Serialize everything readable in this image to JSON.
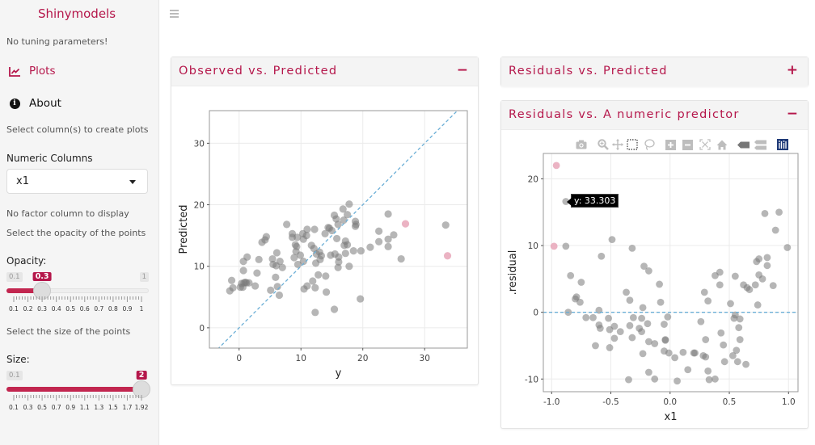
{
  "sidebar": {
    "brand": "Shinymodels",
    "no_tuning": "No tuning parameters!",
    "nav": [
      {
        "label": "Plots",
        "icon": "line-chart-icon",
        "active": true
      },
      {
        "label": "About",
        "icon": "info-circle-icon",
        "active": false
      }
    ],
    "select_columns_text": "Select column(s) to create plots",
    "numeric_columns_label": "Numeric Columns",
    "numeric_columns_value": "x1",
    "no_factor_text": "No factor column to display",
    "opacity_help": "Select the opacity of the points",
    "opacity": {
      "label": "Opacity:",
      "min": 0.1,
      "max": 1,
      "value": 0.3,
      "min_label": "0.1",
      "max_label": "1",
      "value_label": "0.3",
      "tick_labels": [
        "0.1",
        "0.2",
        "0.3",
        "0.4",
        "0.5",
        "0.6",
        "0.7",
        "0.8",
        "0.9",
        "1"
      ]
    },
    "size_help": "Select the size of the points",
    "size": {
      "label": "Size:",
      "min": 0.1,
      "max": 2,
      "value": 2,
      "min_label": "0.1",
      "max_label": "",
      "value_label": "2",
      "tick_labels": [
        "0.1",
        "0.3",
        "0.5",
        "0.7",
        "0.9",
        "1.1",
        "1.3",
        "1.5",
        "1.7",
        "1.92"
      ]
    }
  },
  "panels": [
    {
      "title": "Observed vs. Predicted",
      "tool": "−",
      "tool_name": "collapse"
    },
    {
      "title": "Residuals vs. Predicted",
      "tool": "+",
      "tool_name": "expand"
    },
    {
      "title": "Residuals vs. A numeric predictor",
      "tool": "−",
      "tool_name": "collapse"
    }
  ],
  "modebar": [
    "camera-icon",
    "zoom-icon",
    "pan-icon",
    "box-select-icon",
    "lasso-select-icon",
    "zoom-in-icon",
    "zoom-out-icon",
    "autoscale-icon",
    "reset-axes-icon",
    "hover-closest-icon",
    "hover-compare-icon",
    "plotly-logo-icon"
  ],
  "tooltip": "y: 33.303",
  "colors": {
    "accent": "#b5174b",
    "point": "#7a7a7a",
    "highlight": "#e8a6b9",
    "reference_line": "#6aaed6"
  },
  "chart_data": [
    {
      "type": "scatter",
      "title": "Observed vs. Predicted",
      "xlabel": "y",
      "ylabel": "Predicted",
      "xlim": [
        -4.8,
        36.9
      ],
      "ylim": [
        -3.3,
        35.3
      ],
      "xticks": [
        0,
        10,
        20,
        30
      ],
      "yticks": [
        0,
        10,
        20,
        30
      ],
      "grid": true,
      "reference_line": {
        "slope": 1,
        "intercept": 0,
        "style": "dashed"
      },
      "points": [
        [
          -1.5,
          6.0
        ],
        [
          -1.2,
          7.7
        ],
        [
          -1.0,
          6.5
        ],
        [
          0.2,
          6.6
        ],
        [
          0.4,
          7.2
        ],
        [
          0.6,
          6.6
        ],
        [
          0.8,
          7.3
        ],
        [
          1.0,
          7.4
        ],
        [
          1.2,
          7.3
        ],
        [
          1.6,
          7.3
        ],
        [
          0.7,
          9.3
        ],
        [
          0.7,
          10.8
        ],
        [
          1.3,
          11.5
        ],
        [
          2.6,
          6.8
        ],
        [
          2.9,
          8.9
        ],
        [
          3.2,
          11.1
        ],
        [
          3.7,
          13.9
        ],
        [
          4.2,
          14.3
        ],
        [
          4.4,
          14.8
        ],
        [
          5.1,
          6.1
        ],
        [
          5.4,
          11.2
        ],
        [
          5.5,
          10.3
        ],
        [
          5.9,
          8.2
        ],
        [
          6.0,
          10.1
        ],
        [
          6.1,
          12.2
        ],
        [
          6.2,
          6.7
        ],
        [
          6.5,
          5.3
        ],
        [
          6.6,
          10.8
        ],
        [
          7.0,
          9.8
        ],
        [
          7.7,
          16.8
        ],
        [
          8.6,
          14.7
        ],
        [
          8.6,
          15.3
        ],
        [
          8.9,
          11.4
        ],
        [
          9.1,
          13.5
        ],
        [
          9.2,
          12.4
        ],
        [
          9.3,
          13.2
        ],
        [
          9.4,
          14.7
        ],
        [
          9.5,
          10.3
        ],
        [
          9.9,
          11.8
        ],
        [
          10.3,
          15.3
        ],
        [
          10.4,
          14.4
        ],
        [
          10.4,
          10.8
        ],
        [
          10.5,
          6.3
        ],
        [
          10.9,
          15.0
        ],
        [
          11.0,
          16.0
        ],
        [
          11.0,
          6.8
        ],
        [
          11.7,
          13.4
        ],
        [
          11.9,
          7.6
        ],
        [
          12.1,
          12.9
        ],
        [
          12.2,
          16.0
        ],
        [
          12.3,
          6.5
        ],
        [
          12.4,
          10.5
        ],
        [
          12.5,
          12.0
        ],
        [
          12.8,
          8.6
        ],
        [
          13.0,
          12.3
        ],
        [
          13.1,
          11.1
        ],
        [
          13.3,
          11.7
        ],
        [
          13.9,
          15.3
        ],
        [
          14.0,
          8.4
        ],
        [
          14.1,
          5.8
        ],
        [
          14.4,
          16.3
        ],
        [
          14.6,
          16.2
        ],
        [
          14.8,
          11.8
        ],
        [
          15.0,
          15.8
        ],
        [
          15.4,
          18.3
        ],
        [
          15.4,
          3.0
        ],
        [
          15.5,
          12.0
        ],
        [
          15.7,
          17.7
        ],
        [
          15.8,
          14.5
        ],
        [
          16.0,
          16.8
        ],
        [
          16.0,
          9.8
        ],
        [
          16.1,
          11.5
        ],
        [
          16.1,
          10.7
        ],
        [
          16.8,
          19.3
        ],
        [
          16.9,
          17.5
        ],
        [
          17.0,
          13.4
        ],
        [
          17.2,
          14.1
        ],
        [
          17.2,
          12.1
        ],
        [
          17.5,
          13.5
        ],
        [
          17.5,
          18.4
        ],
        [
          17.8,
          20.1
        ],
        [
          17.8,
          10.0
        ],
        [
          18.5,
          12.5
        ],
        [
          18.8,
          17.3
        ],
        [
          18.8,
          16.5
        ],
        [
          18.9,
          16.8
        ],
        [
          19.6,
          4.7
        ],
        [
          19.7,
          12.5
        ],
        [
          21.2,
          13.1
        ],
        [
          22.6,
          15.7
        ],
        [
          22.6,
          14.0
        ],
        [
          24.1,
          18.5
        ],
        [
          24.1,
          14.4
        ],
        [
          24.1,
          13.2
        ],
        [
          25.0,
          15.1
        ],
        [
          26.2,
          11.2
        ],
        [
          33.4,
          16.7
        ],
        [
          12.3,
          2.5
        ]
      ],
      "highlighted_points": [
        [
          26.9,
          16.9
        ],
        [
          33.7,
          11.7
        ]
      ]
    },
    {
      "type": "scatter",
      "title": "Residuals vs. A numeric predictor",
      "xlabel": "x1",
      "ylabel": ".residual",
      "xlim": [
        -1.07,
        1.08
      ],
      "ylim": [
        -11.9,
        23.8
      ],
      "xticks": [
        -1.0,
        -0.5,
        0.0,
        0.5,
        1.0
      ],
      "xtick_labels": [
        "-1.0",
        "-0.5",
        "0.0",
        "0.5",
        "1.0"
      ],
      "yticks": [
        -10,
        0,
        10,
        20
      ],
      "grid": true,
      "reference_line": {
        "slope": 0,
        "intercept": 0,
        "style": "dashed"
      },
      "points": [
        [
          -0.88,
          16.6
        ],
        [
          -0.88,
          9.9
        ],
        [
          -0.84,
          5.5
        ],
        [
          -0.86,
          0.0
        ],
        [
          -0.8,
          2.0
        ],
        [
          -0.79,
          2.3
        ],
        [
          -0.76,
          1.5
        ],
        [
          -0.75,
          4.5
        ],
        [
          -0.71,
          -0.8
        ],
        [
          -0.65,
          -0.8
        ],
        [
          -0.63,
          -5.0
        ],
        [
          -0.6,
          0.3
        ],
        [
          -0.6,
          -1.9
        ],
        [
          -0.59,
          -2.4
        ],
        [
          -0.58,
          8.4
        ],
        [
          -0.52,
          -0.9
        ],
        [
          -0.51,
          -2.6
        ],
        [
          -0.51,
          -5.3
        ],
        [
          -0.49,
          10.9
        ],
        [
          -0.47,
          -2.1
        ],
        [
          -0.47,
          -3.9
        ],
        [
          -0.42,
          -2.9
        ],
        [
          -0.37,
          3.0
        ],
        [
          -0.35,
          -10.1
        ],
        [
          -0.34,
          1.8
        ],
        [
          -0.34,
          -2.0
        ],
        [
          -0.32,
          -3.8
        ],
        [
          -0.32,
          9.6
        ],
        [
          -0.31,
          -0.8
        ],
        [
          -0.26,
          -2.4
        ],
        [
          -0.24,
          -0.9
        ],
        [
          -0.24,
          -2.9
        ],
        [
          -0.23,
          -6.2
        ],
        [
          -0.23,
          0.7
        ],
        [
          -0.22,
          6.9
        ],
        [
          -0.19,
          -1.7
        ],
        [
          -0.18,
          6.2
        ],
        [
          -0.18,
          -4.4
        ],
        [
          -0.18,
          -9.0
        ],
        [
          -0.13,
          -4.7
        ],
        [
          -0.13,
          -10.0
        ],
        [
          -0.09,
          4.2
        ],
        [
          -0.08,
          1.5
        ],
        [
          -0.05,
          -1.8
        ],
        [
          -0.05,
          -5.8
        ],
        [
          -0.04,
          -4.1
        ],
        [
          -0.04,
          -4.2
        ],
        [
          -0.02,
          -0.7
        ],
        [
          -0.01,
          -6.1
        ],
        [
          0.04,
          -6.8
        ],
        [
          0.06,
          -10.3
        ],
        [
          0.11,
          -6.0
        ],
        [
          0.15,
          -8.6
        ],
        [
          0.2,
          -6.1
        ],
        [
          0.21,
          -6.1
        ],
        [
          0.26,
          -1.4
        ],
        [
          0.28,
          -6.5
        ],
        [
          0.29,
          3.0
        ],
        [
          0.3,
          -6.7
        ],
        [
          0.3,
          -4.1
        ],
        [
          0.32,
          1.7
        ],
        [
          0.32,
          -8.8
        ],
        [
          0.33,
          -10.1
        ],
        [
          0.38,
          5.5
        ],
        [
          0.38,
          -10.0
        ],
        [
          0.42,
          6.0
        ],
        [
          0.42,
          4.1
        ],
        [
          0.43,
          -3.1
        ],
        [
          0.45,
          -4.9
        ],
        [
          0.46,
          -7.4
        ],
        [
          0.51,
          1.3
        ],
        [
          0.53,
          -6.5
        ],
        [
          0.54,
          -0.9
        ],
        [
          0.55,
          5.4
        ],
        [
          0.55,
          -0.4
        ],
        [
          0.56,
          -5.7
        ],
        [
          0.57,
          -7.4
        ],
        [
          0.58,
          -2.3
        ],
        [
          0.59,
          -1.0
        ],
        [
          0.59,
          -4.1
        ],
        [
          0.62,
          4.1
        ],
        [
          0.64,
          -7.8
        ],
        [
          0.65,
          3.7
        ],
        [
          0.67,
          3.4
        ],
        [
          0.72,
          4.1
        ],
        [
          0.73,
          7.6
        ],
        [
          0.74,
          1.1
        ],
        [
          0.75,
          5.6
        ],
        [
          0.75,
          8.0
        ],
        [
          0.78,
          5.0
        ],
        [
          0.8,
          14.8
        ],
        [
          0.82,
          7.0
        ],
        [
          0.82,
          8.2
        ],
        [
          0.87,
          4.0
        ],
        [
          0.89,
          12.3
        ],
        [
          0.92,
          15.0
        ],
        [
          0.99,
          9.7
        ]
      ],
      "highlighted_points": [
        [
          -0.96,
          22.0
        ],
        [
          -0.98,
          9.9
        ]
      ]
    }
  ]
}
